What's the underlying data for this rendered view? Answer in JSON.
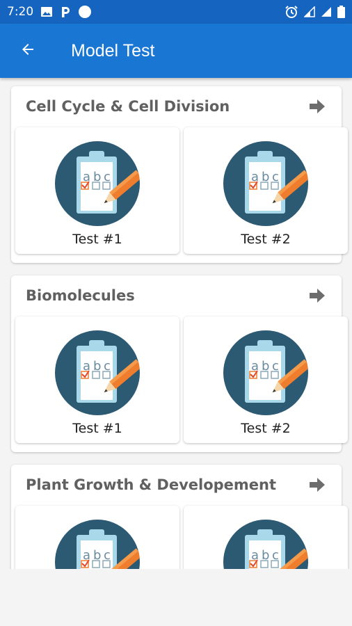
{
  "status_bar": {
    "time": "7:20",
    "left_icons": [
      "image-icon",
      "parking-p-icon",
      "circle-icon"
    ],
    "right_icons": [
      "alarm-icon",
      "signal-icon",
      "signal-icon",
      "battery-icon"
    ]
  },
  "app_bar": {
    "title": "Model Test",
    "back_icon": "arrow-back-icon"
  },
  "sections": [
    {
      "title": "Cell Cycle & Cell Division",
      "tests": [
        {
          "label": "Test #1"
        },
        {
          "label": "Test #2"
        }
      ]
    },
    {
      "title": "Biomolecules",
      "tests": [
        {
          "label": "Test #1"
        },
        {
          "label": "Test #2"
        }
      ]
    },
    {
      "title": "Plant Growth & Developement",
      "tests": [
        {
          "label": ""
        },
        {
          "label": ""
        }
      ]
    }
  ],
  "icon_text": {
    "a": "a",
    "b": "b",
    "c": "c"
  },
  "colors": {
    "status_bar": "#1565c0",
    "app_bar": "#1976d2",
    "icon_circle": "#2c5a73",
    "clipboard": "#a8d8ea",
    "pencil": "#ef7d2e"
  }
}
